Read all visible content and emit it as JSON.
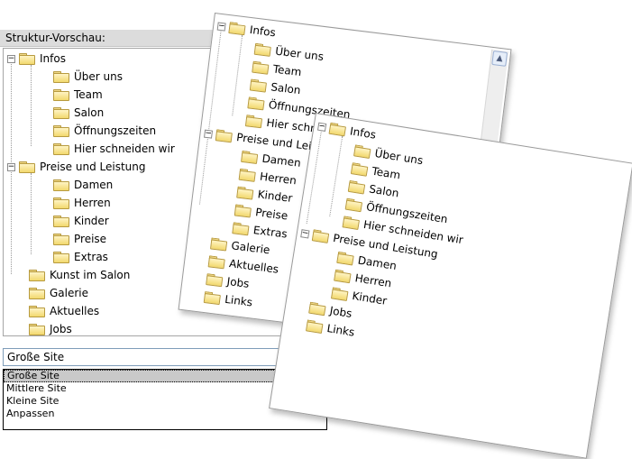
{
  "preview_label": "Struktur-Vorschau:",
  "tree": {
    "infos": "Infos",
    "infos_children": [
      "Über uns",
      "Team",
      "Salon",
      "Öffnungszeiten",
      "Hier schneiden wir"
    ],
    "preise": "Preise und Leistung",
    "preise_children": [
      "Damen",
      "Herren",
      "Kinder",
      "Preise",
      "Extras"
    ],
    "rest": [
      "Kunst im Salon",
      "Galerie",
      "Aktuelles",
      "Jobs"
    ]
  },
  "combo": {
    "value": "Große Site"
  },
  "site_options": [
    "Große Site",
    "Mittlere Site",
    "Kleine Site",
    "Anpassen"
  ],
  "panel_a": {
    "infos": "Infos",
    "infos_children": [
      "Über uns",
      "Team",
      "Salon",
      "Öffnungszeiten",
      "Hier schneiden wir"
    ],
    "preise": "Preise und Leistung",
    "preise_children": [
      "Damen",
      "Herren",
      "Kinder",
      "Preise",
      "Extras"
    ],
    "rest": [
      "Galerie",
      "Aktuelles",
      "Jobs",
      "Links"
    ]
  },
  "panel_b": {
    "infos": "Infos",
    "infos_children": [
      "Über uns",
      "Team",
      "Salon",
      "Öffnungszeiten",
      "Hier schneiden wir"
    ],
    "preise": "Preise und Leistung",
    "preise_children": [
      "Damen",
      "Herren",
      "Kinder"
    ],
    "rest": [
      "Jobs",
      "Links"
    ]
  },
  "icons": {
    "toggle": "minus-toggle-icon",
    "folder": "folder-icon",
    "scroll_up": "scroll-up-arrow-icon"
  }
}
